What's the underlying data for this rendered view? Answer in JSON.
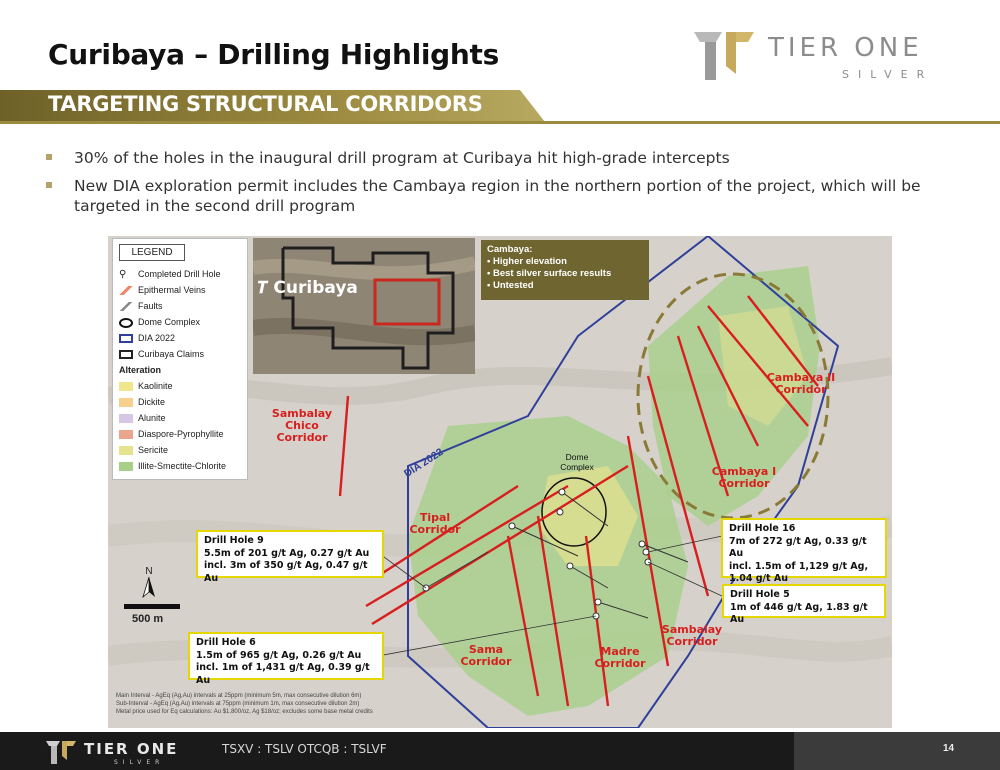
{
  "header": {
    "title": "Curibaya – Drilling Highlights",
    "banner": "TARGETING STRUCTURAL CORRIDORS"
  },
  "logo": {
    "word1": "TIER ONE",
    "word2": "SILVER"
  },
  "bullets": [
    "30% of the holes in the inaugural drill program at Curibaya hit high-grade intercepts",
    "New DIA exploration permit includes the Cambaya region in the northern portion of the project, which will be targeted in the second drill program"
  ],
  "legend": {
    "title": "LEGEND",
    "items": [
      {
        "label": "Completed Drill Hole",
        "icon": "drill-hole-icon"
      },
      {
        "label": "Epithermal Veins",
        "icon": "vein-icon"
      },
      {
        "label": "Faults",
        "icon": "fault-icon"
      },
      {
        "label": "Dome Complex",
        "icon": "dome-icon"
      },
      {
        "label": "DIA 2022",
        "icon": "dia-boundary-icon"
      },
      {
        "label": "Curibaya Claims",
        "icon": "claims-boundary-icon"
      }
    ],
    "alteration_heading": "Alteration",
    "alteration": [
      {
        "label": "Kaolinite",
        "color": "#f2e68c"
      },
      {
        "label": "Dickite",
        "color": "#f6d08e"
      },
      {
        "label": "Alunite",
        "color": "#d7c7e6"
      },
      {
        "label": "Diaspore-Pyrophyllite",
        "color": "#eaa58f"
      },
      {
        "label": "Sericite",
        "color": "#e6e28f"
      },
      {
        "label": "Illite-Smectite-Chlorite",
        "color": "#a8cf8a"
      }
    ]
  },
  "inset": {
    "label": "Curibaya"
  },
  "cambaya_box": {
    "title": "Cambaya:",
    "items": [
      "Higher elevation",
      "Best silver surface results",
      "Untested"
    ]
  },
  "map_labels": {
    "sambalay_chico": "Sambalay Chico Corridor",
    "cambaya_ii": "Cambaya II Corridor",
    "cambaya_i": "Cambaya I Corridor",
    "tipal": "Tipal Corridor",
    "sama": "Sama Corridor",
    "madre": "Madre Corridor",
    "sambalay": "Sambalay Corridor",
    "dia": "DIA 2022",
    "dome": "Dome Complex"
  },
  "callouts": {
    "dh9": {
      "title": "Drill Hole 9",
      "line1": "5.5m of 201 g/t Ag, 0.27 g/t Au",
      "line2": "incl. 3m of 350 g/t Ag, 0.47 g/t Au"
    },
    "dh6": {
      "title": "Drill Hole 6",
      "line1": "1.5m of 965 g/t Ag, 0.26 g/t Au",
      "line2": "incl. 1m of 1,431 g/t Ag, 0.39 g/t Au"
    },
    "dh16": {
      "title": "Drill Hole 16",
      "line1": "7m of 272 g/t Ag, 0.33 g/t Au",
      "line2": "incl. 1.5m of 1,129 g/t Ag,",
      "line3": "1.04 g/t Au"
    },
    "dh5": {
      "title": "Drill Hole 5",
      "line1": "1m of 446 g/t Ag, 1.83 g/t Au"
    }
  },
  "north_label": "N",
  "scale_label": "500 m",
  "footnotes": [
    "Main Interval - AgEq (Ag,Au) intervals at 25ppm (minimum 5m, max consecutive dilution 6m)",
    "Sub-Interval - AgEq (Ag,Au) intervals at 75ppm (minimum 1m, max consecutive dilution 2m)",
    "Metal price used for Eq calculations: Au $1,800/oz, Ag $18/oz; excludes some base metal credits"
  ],
  "footer": {
    "ticker": "TSXV : TSLV   OTCQB : TSLVF",
    "page": "14"
  },
  "colors": {
    "gold": "#9b8a3f",
    "banner_dark": "#8a7a37",
    "callout_border": "#e5d800",
    "corridor_red": "#d81e1e",
    "dia_blue": "#2f3f9a"
  }
}
